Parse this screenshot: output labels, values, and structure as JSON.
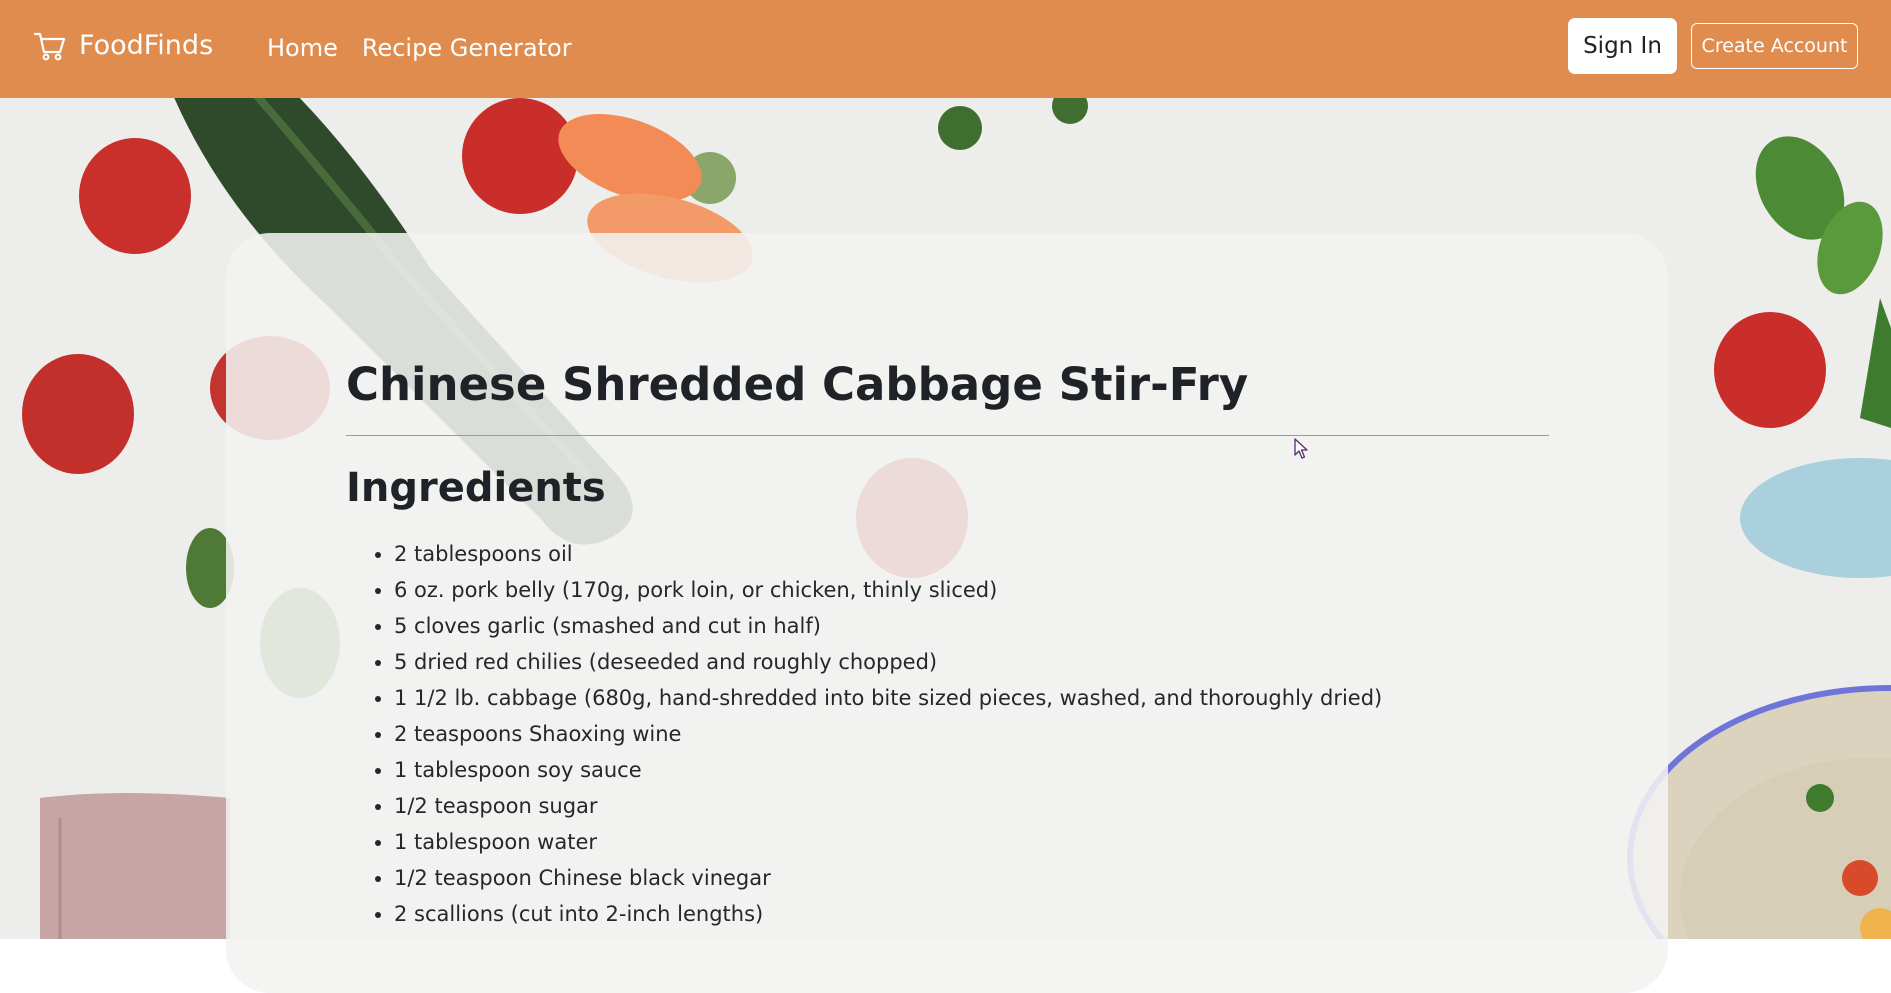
{
  "navbar": {
    "brand": "FoodFinds",
    "brand_icon": "cart-icon",
    "links": [
      "Home",
      "Recipe Generator"
    ],
    "sign_in_label": "Sign In",
    "create_account_label": "Create Account",
    "colors": {
      "bar": "#e08c4e",
      "text": "#ffffff"
    }
  },
  "recipe": {
    "title": "Chinese Shredded Cabbage Stir-Fry",
    "ingredients_heading": "Ingredients",
    "ingredients": [
      "2 tablespoons oil",
      "6 oz. pork belly (170g, pork loin, or chicken, thinly sliced)",
      "5 cloves garlic (smashed and cut in half)",
      "5 dried red chilies (deseeded and roughly chopped)",
      "1 1/2 lb. cabbage (680g, hand-shredded into bite sized pieces, washed, and thoroughly dried)",
      "2 teaspoons Shaoxing wine",
      "1 tablespoon soy sauce",
      "1/2 teaspoon sugar",
      "1 tablespoon water",
      "1/2 teaspoon Chinese black vinegar",
      "2 scallions (cut into 2-inch lengths)"
    ]
  }
}
